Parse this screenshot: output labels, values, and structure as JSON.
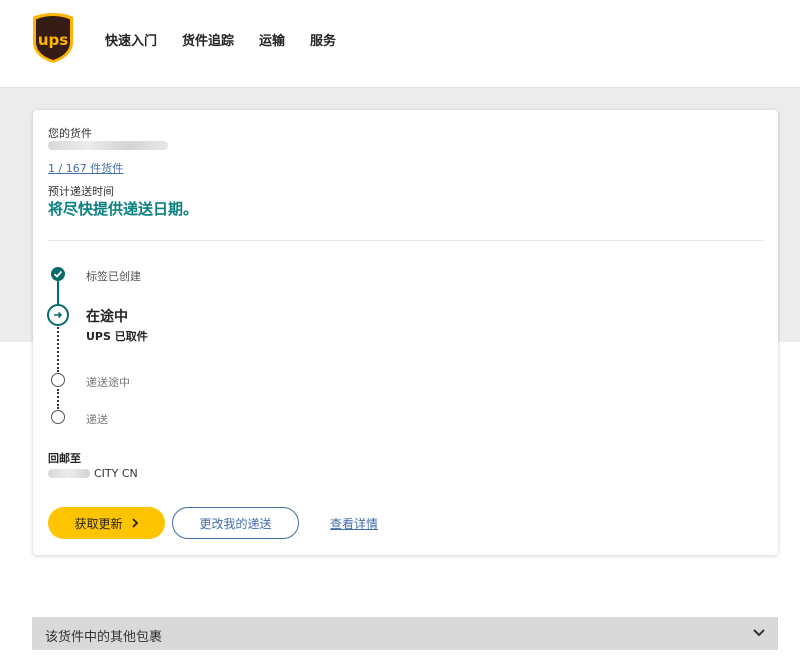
{
  "brand": {
    "logo_text": "ups",
    "shield_color": "#351c15",
    "accent_color": "#ffb500"
  },
  "nav": {
    "items": [
      {
        "label": "快速入门"
      },
      {
        "label": "货件追踪"
      },
      {
        "label": "运输"
      },
      {
        "label": "服务"
      }
    ]
  },
  "shipment": {
    "your_package_label": "您的货件",
    "package_count": "1 / 167 件货件",
    "eta_label": "预计递送时间",
    "eta_value": "将尽快提供递送日期。",
    "status_color": "#0a8080"
  },
  "progress": {
    "steps": [
      {
        "label": "标签已创建",
        "state": "done",
        "icon": "check-icon"
      },
      {
        "label": "在途中",
        "sublabel": "UPS 已取件",
        "state": "current",
        "icon": "arrow-right-icon"
      },
      {
        "label": "递送途中",
        "state": "pending",
        "icon": "circle-icon"
      },
      {
        "label": "递送",
        "state": "pending",
        "icon": "circle-icon"
      }
    ]
  },
  "return_to": {
    "label": "回邮至",
    "city": "CITY CN"
  },
  "actions": {
    "update_label": "获取更新",
    "change_label": "更改我的递送",
    "details_label": "查看详情"
  },
  "other_packages": {
    "title": "该货件中的其他包裹",
    "icon": "chevron-down-icon"
  }
}
